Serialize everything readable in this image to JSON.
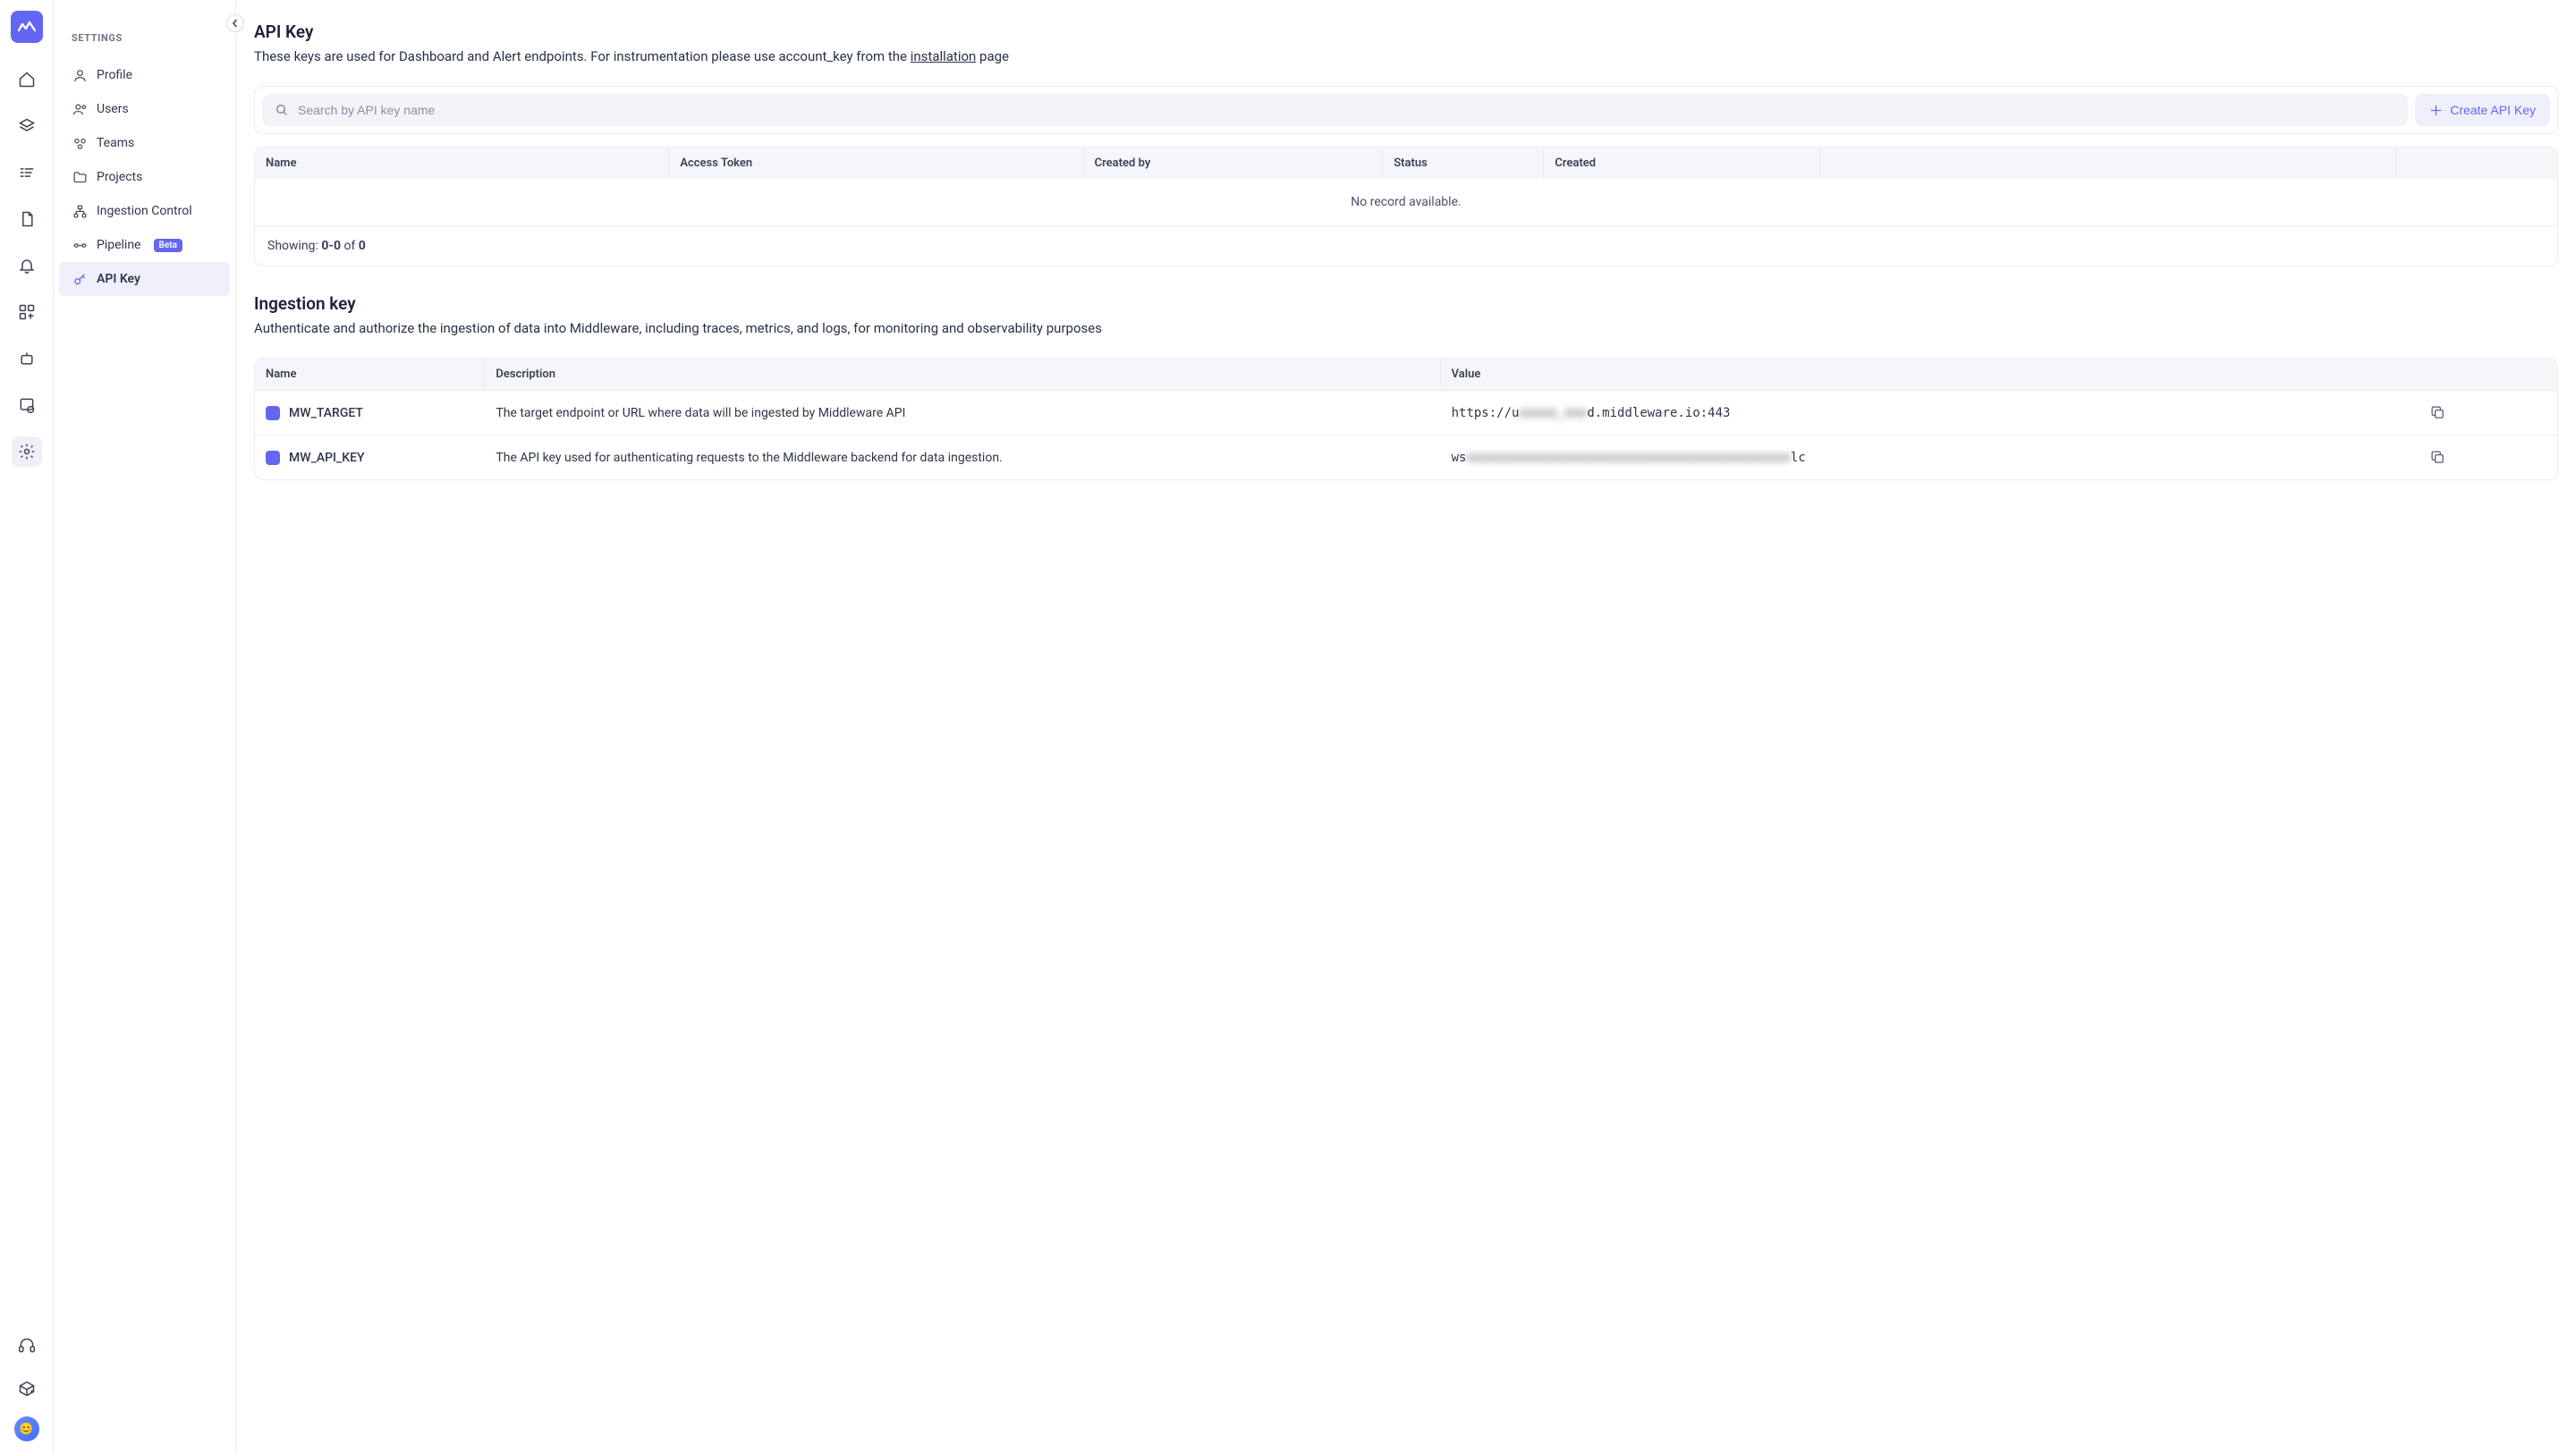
{
  "sidebar": {
    "heading": "SETTINGS",
    "items": [
      {
        "label": "Profile"
      },
      {
        "label": "Users"
      },
      {
        "label": "Teams"
      },
      {
        "label": "Projects"
      },
      {
        "label": "Ingestion Control"
      },
      {
        "label": "Pipeline",
        "badge": "Beta"
      },
      {
        "label": "API Key"
      }
    ]
  },
  "apikey": {
    "title": "API Key",
    "desc_pre": "These keys are used for Dashboard and Alert endpoints. For instrumentation please use account_key from the ",
    "desc_link": "installation",
    "desc_post": " page",
    "search_placeholder": "Search by API key name",
    "create_label": "Create API Key",
    "columns": [
      "Name",
      "Access Token",
      "Created by",
      "Status",
      "Created",
      "",
      ""
    ],
    "empty": "No record available.",
    "footer_prefix": "Showing: ",
    "footer_range": "0-0",
    "footer_of": " of ",
    "footer_total": "0"
  },
  "ingestion": {
    "title": "Ingestion key",
    "desc": "Authenticate and authorize the ingestion of data into Middleware, including traces, metrics, and logs, for monitoring and observability purposes",
    "columns": [
      "Name",
      "Description",
      "Value"
    ],
    "rows": [
      {
        "name": "MW_TARGET",
        "desc": "The target endpoint or URL where data will be ingested by Middleware API",
        "val_pre": "https://u",
        "val_blur": "xxxxx_xxx",
        "val_post": "d.middleware.io:443"
      },
      {
        "name": "MW_API_KEY",
        "desc": "The API key used for authenticating requests to the Middleware backend for data ingestion.",
        "val_pre": "ws",
        "val_blur": "xxxxxxxxxxxxxxxxxxxxxxxxxxxxxxxxxxxxxxxxxxx",
        "val_post": "lc"
      }
    ]
  }
}
